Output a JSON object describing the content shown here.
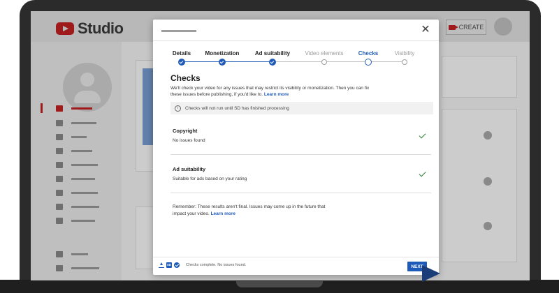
{
  "app": {
    "logo_text": "Studio",
    "create_label": "CREATE"
  },
  "dialog": {
    "close_glyph": "✕",
    "steps": [
      {
        "label": "Details",
        "state": "done"
      },
      {
        "label": "Monetization",
        "state": "done"
      },
      {
        "label": "Ad suitability",
        "state": "done"
      },
      {
        "label": "Video elements",
        "state": "pending"
      },
      {
        "label": "Checks",
        "state": "current"
      },
      {
        "label": "Visibility",
        "state": "pending"
      }
    ],
    "checks_title": "Checks",
    "checks_desc": "We'll check your video for any issues that may restrict its visibility or monetization. Then you can fix these issues before publishing, if you'd like to.",
    "learn_more": "Learn more",
    "info_icon_glyph": "i",
    "info_text": "Checks will not run until SD has finished processing",
    "copyright_title": "Copyright",
    "copyright_status": "No issues found",
    "ad_title": "Ad suitability",
    "ad_status": "Suitable for ads based on your rating",
    "reminder": "Remember: These results aren't final. Issues may come up in the future that impact your video.",
    "reminder_link": "Learn more",
    "footer_sd": "SD",
    "footer_status": "Checks complete. No issues found.",
    "next_label": "NEXT"
  },
  "colors": {
    "accent": "#1e5bb8",
    "brand_red": "#b51414",
    "check_green": "#2e7d32"
  }
}
